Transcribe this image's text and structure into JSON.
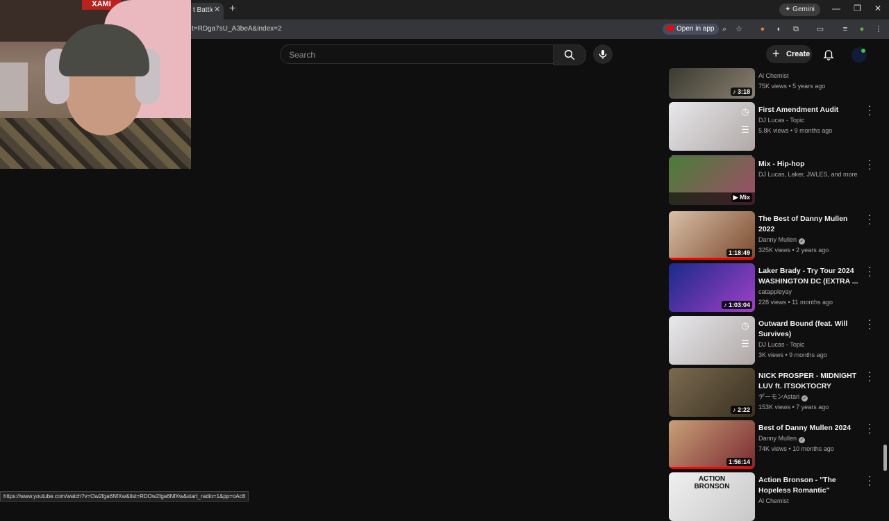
{
  "browser": {
    "tab_title": "t Battle",
    "url": "t=RDga7sU_A3beA&index=2",
    "gemini_label": "Gemini",
    "open_in_app": "Open in app",
    "status_url": "https://www.youtube.com/watch?v=Ow2fga6NfXw&list=RDOw2fga6NfXw&start_radio=1&pp=oAc8"
  },
  "header": {
    "search_placeholder": "Search",
    "create_label": "Create"
  },
  "webcam": {
    "sign_text": "XAMI"
  },
  "related": [
    {
      "title": "",
      "channel": "Al Chemist",
      "views": "75K views • 5 years ago",
      "duration": "3:18",
      "thumb": "#3a3a30",
      "thumb2": "#8a8070",
      "music": true
    },
    {
      "title": "First Amendment Audit",
      "channel": "DJ Lucas - Topic",
      "views": "5.8K views • 9 months ago",
      "duration": "",
      "thumb": "#e8e8ec",
      "thumb2": "#b0a8a6",
      "overlay": true
    },
    {
      "title": "Mix - Hip-hop",
      "channel": "DJ Lucas, Laker, JWLES, and more",
      "views": "",
      "duration": "Mix",
      "thumb": "#4a7d38",
      "thumb2": "#a04c6a",
      "mix": true
    },
    {
      "title": "The Best of Danny Mullen 2022",
      "channel": "Danny Mullen",
      "verified": true,
      "views": "325K views • 2 years ago",
      "duration": "1:18:49",
      "thumb": "#d8c0a8",
      "thumb2": "#7b4a2e",
      "redbar": 124
    },
    {
      "title": "Laker Brady -  Try Tour 2024 WASHINGTON DC (EXTRA ...",
      "channel": "catappleyay",
      "views": "228 views • 11 months ago",
      "duration": "1:03:04",
      "thumb": "#1a2a8a",
      "thumb2": "#a040c8",
      "music": true
    },
    {
      "title": "Outward Bound (feat. Will Survives)",
      "channel": "DJ Lucas - Topic",
      "views": "3K views • 9 months ago",
      "duration": "",
      "thumb": "#e8e8ec",
      "thumb2": "#b0a8a6",
      "overlay": true
    },
    {
      "title": "NICK PROSPER - MIDNIGHT LUV ft. ITSOKTOCRY",
      "channel": "デーモンAstari",
      "verified": true,
      "views": "153K views • 7 years ago",
      "duration": "2:22",
      "thumb": "#7a6a50",
      "thumb2": "#3a3020",
      "music": true
    },
    {
      "title": "Best of Danny Mullen 2024",
      "channel": "Danny Mullen",
      "verified": true,
      "views": "74K views • 10 months ago",
      "duration": "1:56:14",
      "thumb": "#c8a078",
      "thumb2": "#7a2a30",
      "redbar": 124
    },
    {
      "title": "Action Bronson - \"The Hopeless Romantic\" (Alchemist Lunch ...",
      "channel": "Al Chemist",
      "views": "",
      "duration": "",
      "thumb": "#f0f0f0",
      "thumb2": "#c8c8c8",
      "thumb_text": "ACTION BRONSON"
    }
  ],
  "icons": {
    "search": "search-icon",
    "mic": "mic-icon",
    "bell": "bell-icon",
    "kebab": "more-vert-icon",
    "clock": "watch-later-icon",
    "queue": "add-to-queue-icon"
  }
}
